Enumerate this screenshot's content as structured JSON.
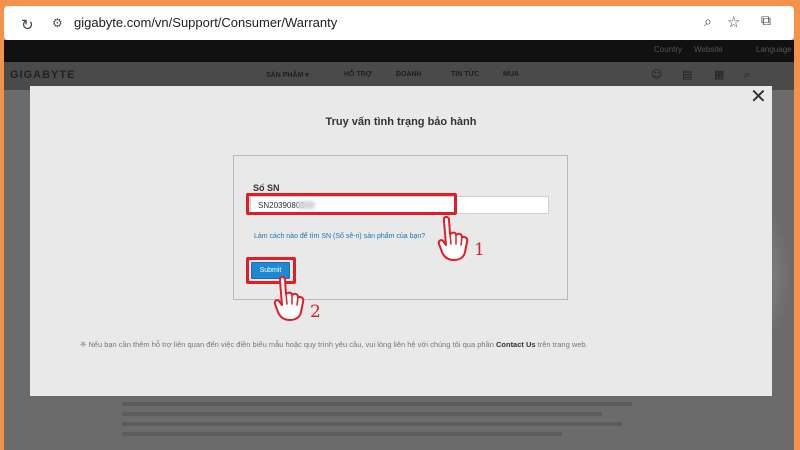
{
  "browser": {
    "url": "gigabyte.com/vn/Support/Consumer/Warranty",
    "icons": [
      "reload-icon",
      "site-info-icon",
      "zoom-icon",
      "bookmark-star-icon",
      "extensions-icon"
    ]
  },
  "site": {
    "logo": "GIGABYTE",
    "nav": [
      "SẢN PHẨM ▾",
      "HỖ TRỢ",
      "ĐOANH",
      "TIN TỨC",
      "MUA"
    ],
    "top_links": [
      "Country",
      "Website",
      "Language"
    ]
  },
  "modal": {
    "title": "Truy vấn tình trạng bảo hành",
    "sn_label": "Số SN",
    "sn_value": "SN20390805",
    "help_link": "Làm cách nào để tìm SN (Số sê-ri) sản phẩm của bạn?",
    "submit_label": "Submit",
    "footnote_prefix": "※ Nếu bạn cần thêm hỗ trợ liên quan đến việc điền biểu mẫu hoặc quy trình yêu cầu, vui lòng liên hệ với chúng tôi qua phần ",
    "footnote_link": "Contact Us",
    "footnote_suffix": " trên trang web."
  },
  "annotations": {
    "step1": "1",
    "step2": "2",
    "highlight_color": "#e31c25"
  }
}
